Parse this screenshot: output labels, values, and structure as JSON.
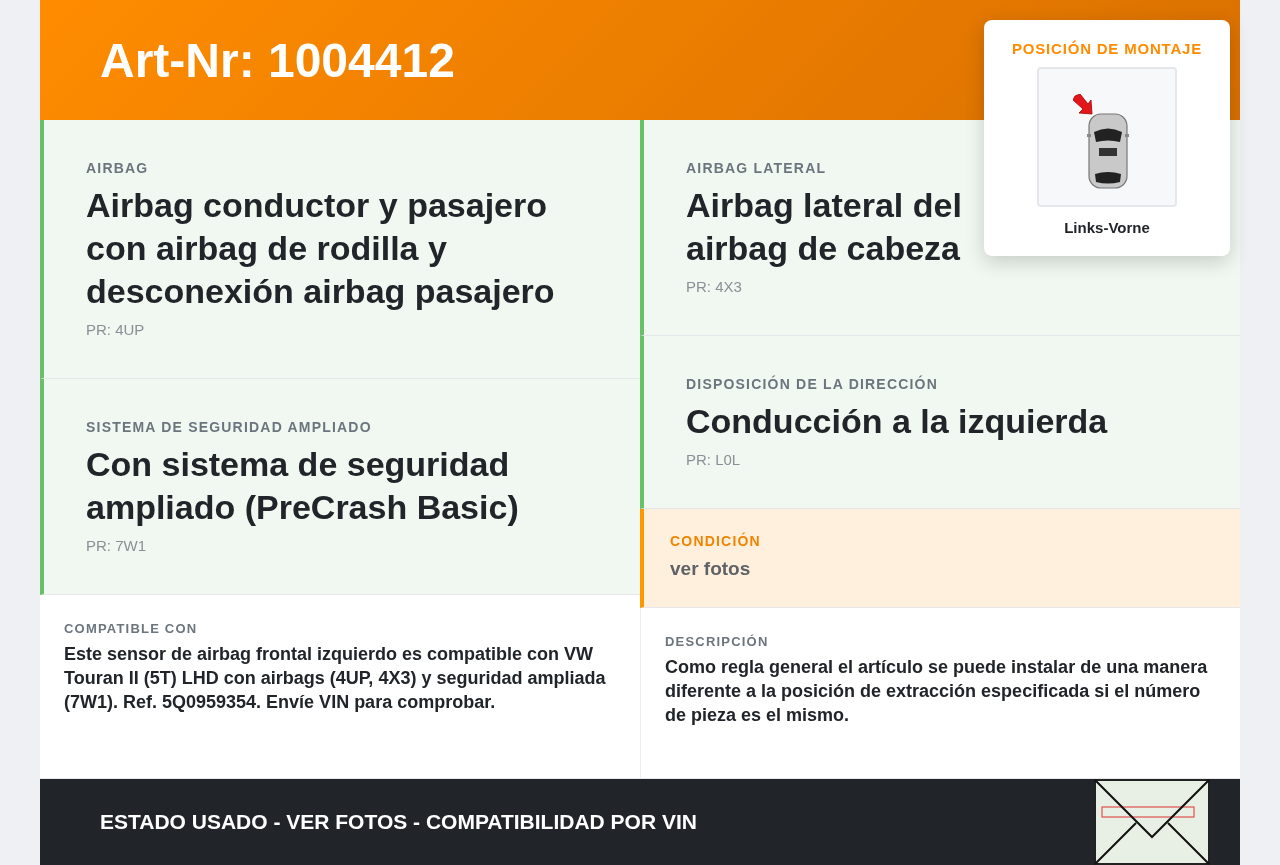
{
  "header": {
    "title": "Art-Nr: 1004412"
  },
  "mounting_position": {
    "label": "POSICIÓN DE MONTAJE",
    "value": "Links-Vorne"
  },
  "columns": [
    [
      {
        "kind": "feature",
        "label": "AIRBAG",
        "title": "Airbag conductor y pasajero con airbag de rodilla y desconexión airbag pasajero",
        "code": "PR: 4UP"
      },
      {
        "kind": "feature",
        "label": "SISTEMA DE SEGURIDAD AMPLIADO",
        "title": "Con sistema de seguridad ampliado (PreCrash Basic)",
        "code": "PR: 7W1"
      },
      {
        "kind": "note",
        "label": "COMPATIBLE CON",
        "text": "Este sensor de airbag frontal izquierdo es compatible con VW Touran II (5T) LHD con airbags (4UP, 4X3) y seguridad ampliada (7W1). Ref. 5Q0959354. Envíe VIN para comprobar."
      }
    ],
    [
      {
        "kind": "feature",
        "label": "AIRBAG LATERAL",
        "title": "Airbag lateral del airbag de cabeza",
        "code": "PR: 4X3"
      },
      {
        "kind": "feature",
        "label": "DISPOSICIÓN DE LA DIRECCIÓN",
        "title": "Conducción a la izquierda",
        "code": "PR: L0L"
      },
      {
        "kind": "condition",
        "label": "CONDICIÓN",
        "text": "ver fotos"
      },
      {
        "kind": "note",
        "label": "DESCRIPCIÓN",
        "text": "Como regla general el artículo se puede instalar de una manera diferente a la posición de extracción especificada si el número de pieza es el mismo."
      }
    ]
  ],
  "footer": {
    "text": "ESTADO USADO - VER FOTOS - COMPATIBILIDAD POR VIN"
  }
}
